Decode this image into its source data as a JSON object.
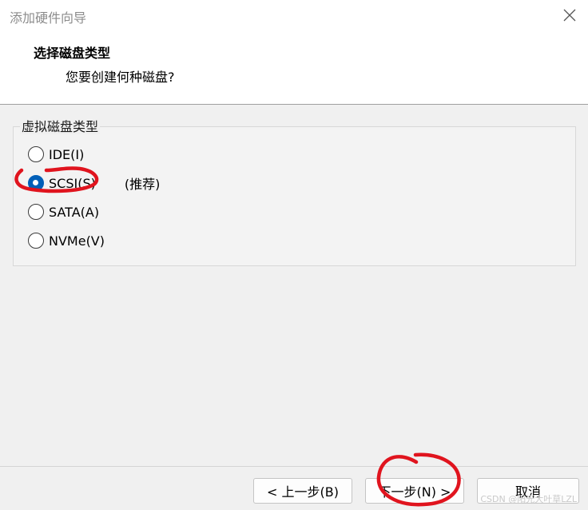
{
  "window": {
    "title": "添加硬件向导",
    "close_icon": "close-icon"
  },
  "header": {
    "title": "选择磁盘类型",
    "subtitle": "您要创建何种磁盘?"
  },
  "disk_type_group": {
    "legend": "虚拟磁盘类型",
    "options": [
      {
        "label": "IDE(I)",
        "selected": false
      },
      {
        "label": "SCSI(S)",
        "selected": true,
        "note": "(推荐)"
      },
      {
        "label": "SATA(A)",
        "selected": false
      },
      {
        "label": "NVMe(V)",
        "selected": false
      }
    ]
  },
  "footer": {
    "back_label": "< 上一步(B)",
    "next_label": "下一步(N) >",
    "cancel_label": "取消"
  },
  "watermark": "CSDN @阳光大叶草LZL",
  "colors": {
    "accent": "#005fb8",
    "annotation": "#e0141e"
  }
}
